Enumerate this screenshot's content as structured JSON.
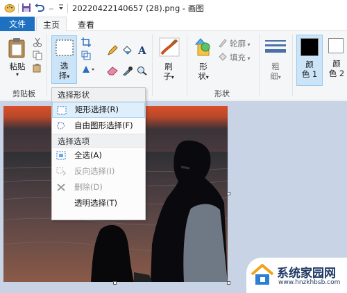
{
  "window": {
    "title": "20220422140657 (28).png - 画图"
  },
  "tabs": {
    "file": "文件",
    "home": "主页",
    "view": "查看"
  },
  "ribbon": {
    "clipboard": {
      "paste": "粘贴",
      "group": "剪贴板"
    },
    "image": {
      "select_line1": "选",
      "select_line2": "择"
    },
    "tools": {},
    "brushes": {
      "line1": "刷",
      "line2": "子"
    },
    "shapes": {
      "shape_line1": "形",
      "shape_line2": "状",
      "outline": "轮廓",
      "fill": "填充",
      "group": "形状"
    },
    "size": {
      "line1": "粗",
      "line2": "细"
    },
    "colors": {
      "color1_line1": "颜",
      "color1_line2": "色 1",
      "color2_line1": "颜",
      "color2_line2": "色 2"
    }
  },
  "select_menu": {
    "header_shape": "选择形状",
    "rect_select": "矩形选择(R)",
    "free_select": "自由图形选择(F)",
    "header_options": "选择选项",
    "select_all": "全选(A)",
    "invert_select": "反向选择(I)",
    "delete": "删除(D)",
    "transparent_select": "透明选择(T)"
  },
  "watermark": {
    "title": "系统家园网",
    "url": "www.hnzkhbsb.com"
  },
  "colors": {
    "accent": "#1e70c1",
    "ribbon_bg": "#f5f6f7",
    "workspace_bg": "#c8d4e5",
    "highlight": "#dfeefb"
  }
}
